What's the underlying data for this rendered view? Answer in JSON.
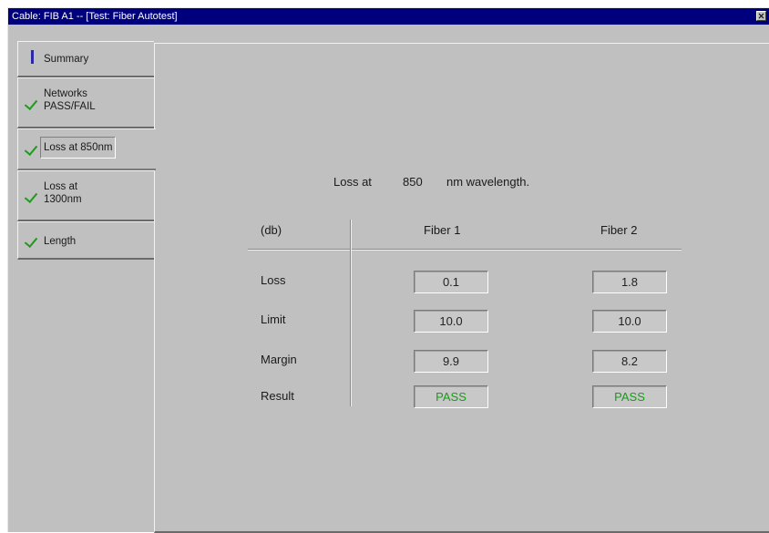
{
  "window": {
    "title": "Cable: FIB A1 -- [Test: Fiber Autotest]"
  },
  "tabs": [
    {
      "label": "Summary",
      "icon": "info-icon"
    },
    {
      "label": "Networks\nPASS/FAIL",
      "icon": "check-icon"
    },
    {
      "label": "Loss at 850nm",
      "icon": "check-icon"
    },
    {
      "label": "Loss at\n1300nm",
      "icon": "check-icon"
    },
    {
      "label": "Length",
      "icon": "check-icon"
    }
  ],
  "panel": {
    "heading_prefix": "Loss at",
    "heading_value": "850",
    "heading_suffix": "nm wavelength.",
    "unit_header": "(db)",
    "columns": [
      "Fiber 1",
      "Fiber 2"
    ],
    "rows": [
      {
        "label": "Loss",
        "values": [
          "0.1",
          "1.8"
        ]
      },
      {
        "label": "Limit",
        "values": [
          "10.0",
          "10.0"
        ]
      },
      {
        "label": "Margin",
        "values": [
          "9.9",
          "8.2"
        ]
      },
      {
        "label": "Result",
        "values": [
          "PASS",
          "PASS"
        ]
      }
    ]
  },
  "colors": {
    "titlebar": "#00007c",
    "pass": "#14a014",
    "check": "#1f9a1f"
  }
}
